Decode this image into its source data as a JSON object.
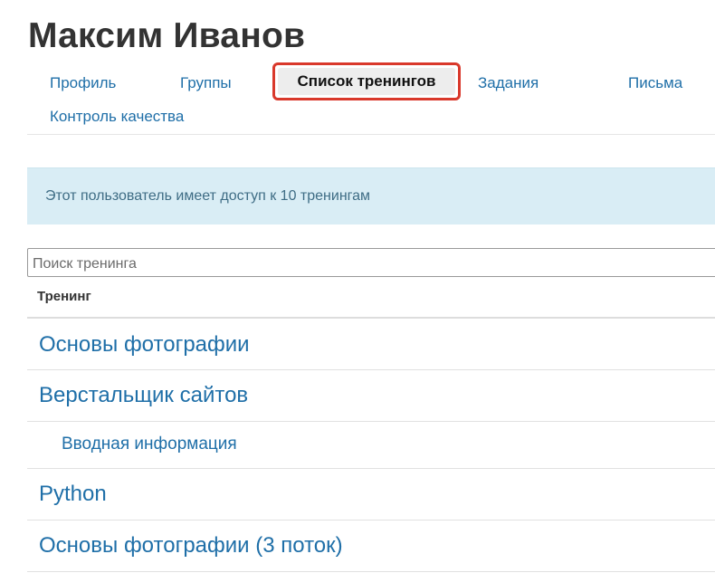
{
  "page": {
    "title": "Максим Иванов"
  },
  "tabs": [
    {
      "label": "Профиль"
    },
    {
      "label": "Группы"
    },
    {
      "label": "Список тренингов",
      "active": true
    },
    {
      "label": "Задания"
    },
    {
      "label": "Письма"
    },
    {
      "label": "Контроль качества"
    }
  ],
  "info": {
    "text": "Этот пользователь имеет доступ к 10 тренингам"
  },
  "search": {
    "placeholder": "Поиск тренинга",
    "value": ""
  },
  "table": {
    "header": "Тренинг",
    "rows": [
      {
        "label": "Основы фотографии",
        "level": 0
      },
      {
        "label": "Верстальщик сайтов",
        "level": 0
      },
      {
        "label": "Вводная информация",
        "level": 1
      },
      {
        "label": "Python",
        "level": 0
      },
      {
        "label": "Основы фотографии (3 поток)",
        "level": 0
      }
    ]
  },
  "colors": {
    "link": "#1f6fa8",
    "highlight_border": "#d9382b",
    "info_bg": "#d9edf5",
    "active_tab_bg": "#ededed"
  }
}
